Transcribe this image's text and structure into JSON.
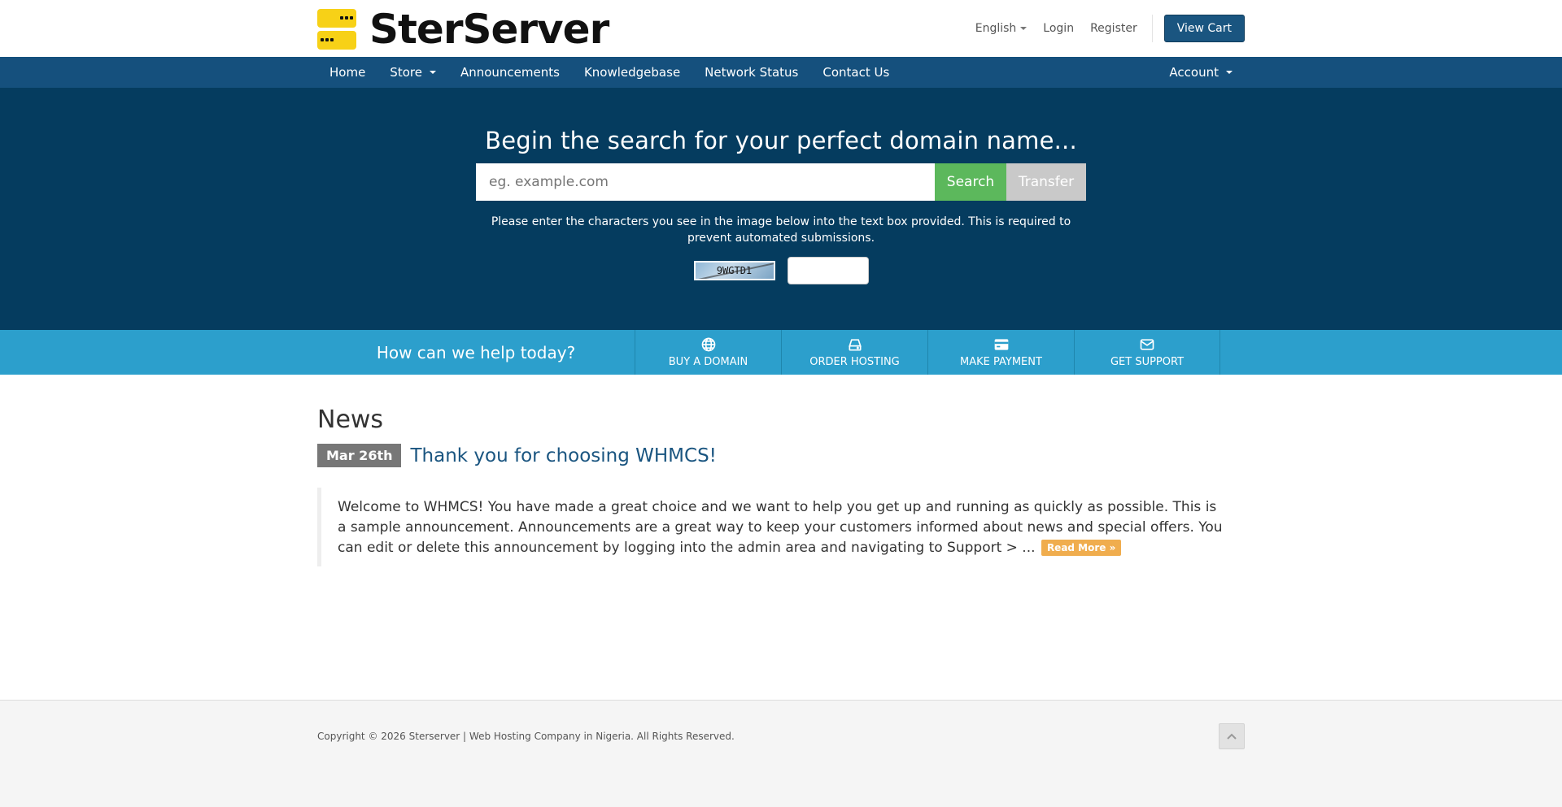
{
  "header": {
    "logo_text": "SterServer",
    "language": "English",
    "login": "Login",
    "register": "Register",
    "view_cart": "View Cart"
  },
  "nav": {
    "items": [
      "Home",
      "Store",
      "Announcements",
      "Knowledgebase",
      "Network Status",
      "Contact Us"
    ],
    "account": "Account"
  },
  "hero": {
    "title": "Begin the search for your perfect domain name...",
    "search_placeholder": "eg. example.com",
    "search_button": "Search",
    "transfer_button": "Transfer",
    "captcha_text": "Please enter the characters you see in the image below into the text box provided. This is required to prevent automated submissions.",
    "captcha_code": "9WGTD1"
  },
  "helpbar": {
    "title": "How can we help today?",
    "items": [
      {
        "label": "BUY A DOMAIN",
        "icon": "globe-icon"
      },
      {
        "label": "ORDER HOSTING",
        "icon": "hdd-icon"
      },
      {
        "label": "MAKE PAYMENT",
        "icon": "credit-card-icon"
      },
      {
        "label": "GET SUPPORT",
        "icon": "envelope-icon"
      }
    ]
  },
  "news": {
    "heading": "News",
    "date": "Mar 26th",
    "title": "Thank you for choosing WHMCS!",
    "body": "Welcome to WHMCS! You have made a great choice and we want to help you get up and running as quickly as possible. This is a sample announcement. Announcements are a great way to keep your customers informed about news and special offers. You can edit or delete this announcement by logging into the admin area and navigating to Support > ...",
    "read_more": "Read More »"
  },
  "footer": {
    "copyright": "Copyright © 2026 Sterserver | Web Hosting Company in Nigeria. All Rights Reserved."
  },
  "colors": {
    "nav_bg": "#15507d",
    "hero_bg": "#053c5f",
    "helpbar_bg": "#2c9fcc",
    "search_green": "#5cb85c",
    "read_more_orange": "#f0ad4e",
    "logo_yellow": "#f7d117"
  }
}
